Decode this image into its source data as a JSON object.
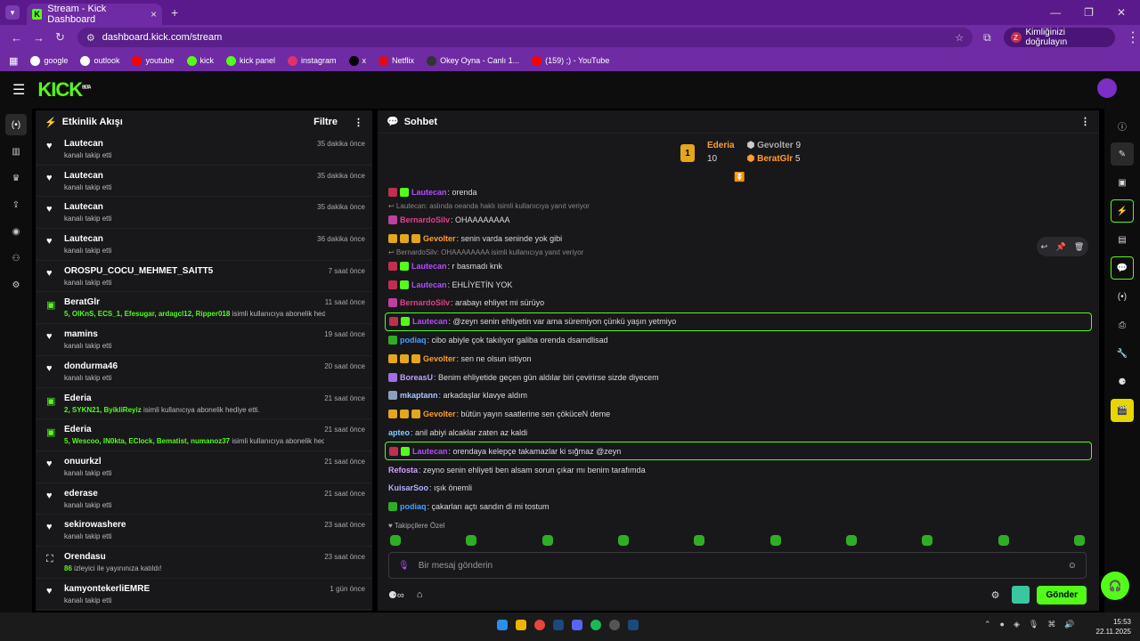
{
  "browser": {
    "tab_title": "Stream - Kick Dashboard",
    "url": "dashboard.kick.com/stream",
    "identity_button": "Kimliğinizi doğrulayın",
    "bookmarks": [
      {
        "label": "google",
        "color": "#ffffff"
      },
      {
        "label": "outlook",
        "color": "#ffffff"
      },
      {
        "label": "youtube",
        "color": "#ff0000"
      },
      {
        "label": "kick",
        "color": "#53fc18"
      },
      {
        "label": "kick panel",
        "color": "#53fc18"
      },
      {
        "label": "instagram",
        "color": "#e1306c"
      },
      {
        "label": "x",
        "color": "#000000"
      },
      {
        "label": "Netflix",
        "color": "#e50914"
      },
      {
        "label": "Okey Oyna - Canlı 1...",
        "color": "#333333"
      },
      {
        "label": "(159) ;) - YouTube",
        "color": "#ff0000"
      }
    ]
  },
  "kick": {
    "logo": "KICK",
    "beta": "BETA",
    "accent": "#53fc18"
  },
  "activity": {
    "title": "Etkinlik Akışı",
    "filter": "Filtre",
    "items": [
      {
        "icon": "heart",
        "name": "Lautecan",
        "desc": "kanalı takip etti",
        "time": "35 dakika önce"
      },
      {
        "icon": "heart",
        "name": "Lautecan",
        "desc": "kanalı takip etti",
        "time": "35 dakika önce"
      },
      {
        "icon": "heart",
        "name": "Lautecan",
        "desc": "kanalı takip etti",
        "time": "35 dakika önce"
      },
      {
        "icon": "heart",
        "name": "Lautecan",
        "desc": "kanalı takip etti",
        "time": "36 dakika önce"
      },
      {
        "icon": "heart",
        "name": "OROSPU_COCU_MEHMET_SAITT5",
        "desc": "kanalı takip etti",
        "time": "7 saat önce"
      },
      {
        "icon": "gift",
        "name": "BeratGlr",
        "desc_green": "5, OlKnS, ECS_1, Efesugar, ardagcl12, Ripper018",
        "desc": " isimli kullanıcıya abonelik hediye etti.",
        "time": "11 saat önce"
      },
      {
        "icon": "heart",
        "name": "mamins",
        "desc": "kanalı takip etti",
        "time": "19 saat önce"
      },
      {
        "icon": "heart",
        "name": "dondurma46",
        "desc": "kanalı takip etti",
        "time": "20 saat önce"
      },
      {
        "icon": "gift",
        "name": "Ederia",
        "desc_green": "2, SYKN21, ByikliReyiz",
        "desc": " isimli kullanıcıya abonelik hediye etti.",
        "time": "21 saat önce"
      },
      {
        "icon": "gift",
        "name": "Ederia",
        "desc_green": "5, Wescoo, IN0kta, EClock, Bematist, numanoz37",
        "desc": " isimli kullanıcıya abonelik hediye etti.",
        "time": "21 saat önce"
      },
      {
        "icon": "heart",
        "name": "onuurkzl",
        "desc": "kanalı takip etti",
        "time": "21 saat önce"
      },
      {
        "icon": "heart",
        "name": "ederase",
        "desc": "kanalı takip etti",
        "time": "21 saat önce"
      },
      {
        "icon": "heart",
        "name": "sekirowashere",
        "desc": "kanalı takip etti",
        "time": "23 saat önce"
      },
      {
        "icon": "raid",
        "name": "Orendasu",
        "desc_green": "86",
        "desc": " izleyici ile yayınınıza katıldı!",
        "time": "23 saat önce"
      },
      {
        "icon": "heart",
        "name": "kamyontekerliEMRE",
        "desc": "kanalı takip etti",
        "time": "1 gün önce"
      }
    ]
  },
  "chat": {
    "title": "Sohbet",
    "leaderboard": {
      "first": {
        "rank": "1",
        "name": "Ederia",
        "count": "10"
      },
      "second": {
        "name": "Gevolter",
        "count": "9"
      },
      "third": {
        "name": "BeratGlr",
        "count": "5"
      }
    },
    "messages": [
      {
        "type": "msg",
        "user": "Lautecan",
        "color": "#b34dff",
        "text": ": orenda",
        "badges": [
          "#c0304e",
          "#53fc18"
        ]
      },
      {
        "type": "reply",
        "text": "↩ Lautecan: aslında oeanda haklı isimli kullanıcıya yanıt veriyor"
      },
      {
        "type": "msg",
        "user": "BernardoSilv",
        "color": "#e0408a",
        "text": ": OHAAAAAAAA",
        "badges": [
          "#c040a0"
        ]
      },
      {
        "type": "msg",
        "user": "Gevolter",
        "color": "#ff9e2e",
        "text": ": senin varda seninde yok gibi",
        "badges": [
          "#e3a61c",
          "#e3a61c",
          "#e3a61c"
        ]
      },
      {
        "type": "reply",
        "text": "↩ BernardoSilv: OHAAAAAAAA isimli kullanıcıya yanıt veriyor"
      },
      {
        "type": "msg",
        "user": "Lautecan",
        "color": "#b34dff",
        "text": ": r basmadı knk",
        "badges": [
          "#c0304e",
          "#53fc18"
        ]
      },
      {
        "type": "msg",
        "user": "Lautecan",
        "color": "#b34dff",
        "text": ": EHLİYETİN YOK",
        "badges": [
          "#c0304e",
          "#53fc18"
        ]
      },
      {
        "type": "msg",
        "user": "BernardoSilv",
        "color": "#e0408a",
        "text": ": arabayı ehliyet mi sürüyo",
        "badges": [
          "#c040a0"
        ]
      },
      {
        "type": "hl",
        "user": "Lautecan",
        "color": "#b34dff",
        "text": ": @zeyn senin ehliyetin var ama süremiyon çünkü yaşın yetmiyo",
        "badges": [
          "#c0304e",
          "#53fc18"
        ]
      },
      {
        "type": "msg",
        "user": "podiaq",
        "color": "#4a9eff",
        "text": ": cibo abiyle çok takılıyor galiba orenda dsamdlisad",
        "badges": [
          "#2fae25"
        ]
      },
      {
        "type": "msg",
        "user": "Gevolter",
        "color": "#ff9e2e",
        "text": ": sen ne olsun istiyon",
        "badges": [
          "#e3a61c",
          "#e3a61c",
          "#e3a61c"
        ]
      },
      {
        "type": "msg",
        "user": "BoreasU",
        "color": "#c0a0ff",
        "text": ": Benim ehliyetide geçen gün aldılar biri çevirirse sizde diyecem",
        "badges": [
          "#a070e0"
        ]
      },
      {
        "type": "msg",
        "user": "mkaptann",
        "color": "#a8c8ff",
        "text": ": arkadaşlar klavye aldım",
        "badges": [
          "#8aa0c0"
        ]
      },
      {
        "type": "msg",
        "user": "Gevolter",
        "color": "#ff9e2e",
        "text": ": bütün yayın saatlerine sen çöküceN deme",
        "badges": [
          "#e3a61c",
          "#e3a61c",
          "#e3a61c"
        ]
      },
      {
        "type": "msg",
        "user": "apteo",
        "color": "#7fd0ff",
        "text": ": anil abiyi alcaklar zaten az kaldi",
        "badges": []
      },
      {
        "type": "hl",
        "user": "Lautecan",
        "color": "#b34dff",
        "text": ": orendaya kelepçe takamazlar ki sığmaz @zeyn",
        "badges": [
          "#c0304e",
          "#53fc18"
        ]
      },
      {
        "type": "msg",
        "user": "Refosta",
        "color": "#d0a0ff",
        "text": ": zeyno senin ehliyeti ben alsam sorun çıkar mı benim tarafımda",
        "badges": []
      },
      {
        "type": "msg",
        "user": "KuisarSoo",
        "color": "#b0b0ff",
        "text": ": ışık önemli",
        "badges": []
      },
      {
        "type": "msg",
        "user": "podiaq",
        "color": "#4a9eff",
        "text": ": çakarları açtı sandın di mi tostum",
        "badges": [
          "#2fae25"
        ]
      }
    ],
    "emote_label": "Takipçilere Özel",
    "input_placeholder": "Bir mesaj gönderin",
    "send_label": "Gönder"
  },
  "taskbar": {
    "time": "15:53",
    "date": "22.11.2025"
  }
}
